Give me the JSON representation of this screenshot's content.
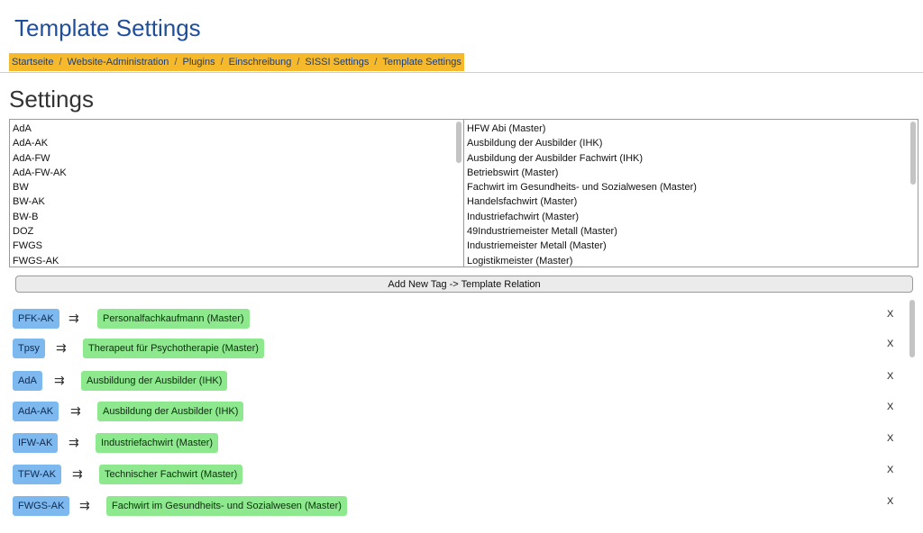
{
  "page": {
    "title": "Template Settings",
    "settings_heading": "Settings"
  },
  "breadcrumb": [
    "Startseite",
    "Website-Administration",
    "Plugins",
    "Einschreibung",
    "SISSI Settings",
    "Template Settings"
  ],
  "tags_list": [
    "AdA",
    "AdA-AK",
    "AdA-FW",
    "AdA-FW-AK",
    "BW",
    "BW-AK",
    "BW-B",
    "DOZ",
    "FWGS",
    "FWGS-AK"
  ],
  "templates_list": [
    "HFW Abi (Master)",
    "Ausbildung der Ausbilder (IHK)",
    "Ausbildung der Ausbilder Fachwirt (IHK)",
    "Betriebswirt (Master)",
    "Fachwirt im Gesundheits- und Sozialwesen (Master)",
    "Handelsfachwirt (Master)",
    "Industriefachwirt (Master)",
    "49Industriemeister Metall (Master)",
    "Industriemeister Metall (Master)",
    "Logistikmeister (Master)"
  ],
  "add_button_label": "Add New Tag -> Template Relation",
  "arrow_symbol": "⇉",
  "remove_label": "X",
  "relations": [
    {
      "tag": "PFK-AK",
      "template": "Personalfachkaufmann (Master)"
    },
    {
      "tag": "Tpsy",
      "template": "Therapeut für Psychotherapie (Master)"
    },
    {
      "tag": "AdA",
      "template": "Ausbildung der Ausbilder (IHK)"
    },
    {
      "tag": "AdA-AK",
      "template": "Ausbildung der Ausbilder (IHK)"
    },
    {
      "tag": "IFW-AK",
      "template": "Industriefachwirt (Master)"
    },
    {
      "tag": "TFW-AK",
      "template": "Technischer Fachwirt (Master)"
    },
    {
      "tag": "FWGS-AK",
      "template": "Fachwirt im Gesundheits- und Sozialwesen (Master)"
    }
  ],
  "colors": {
    "title": "#1f4e9a",
    "breadcrumb_bg": "#f6b92b",
    "tag_bg": "#7db8ef",
    "template_bg": "#8de88e"
  }
}
